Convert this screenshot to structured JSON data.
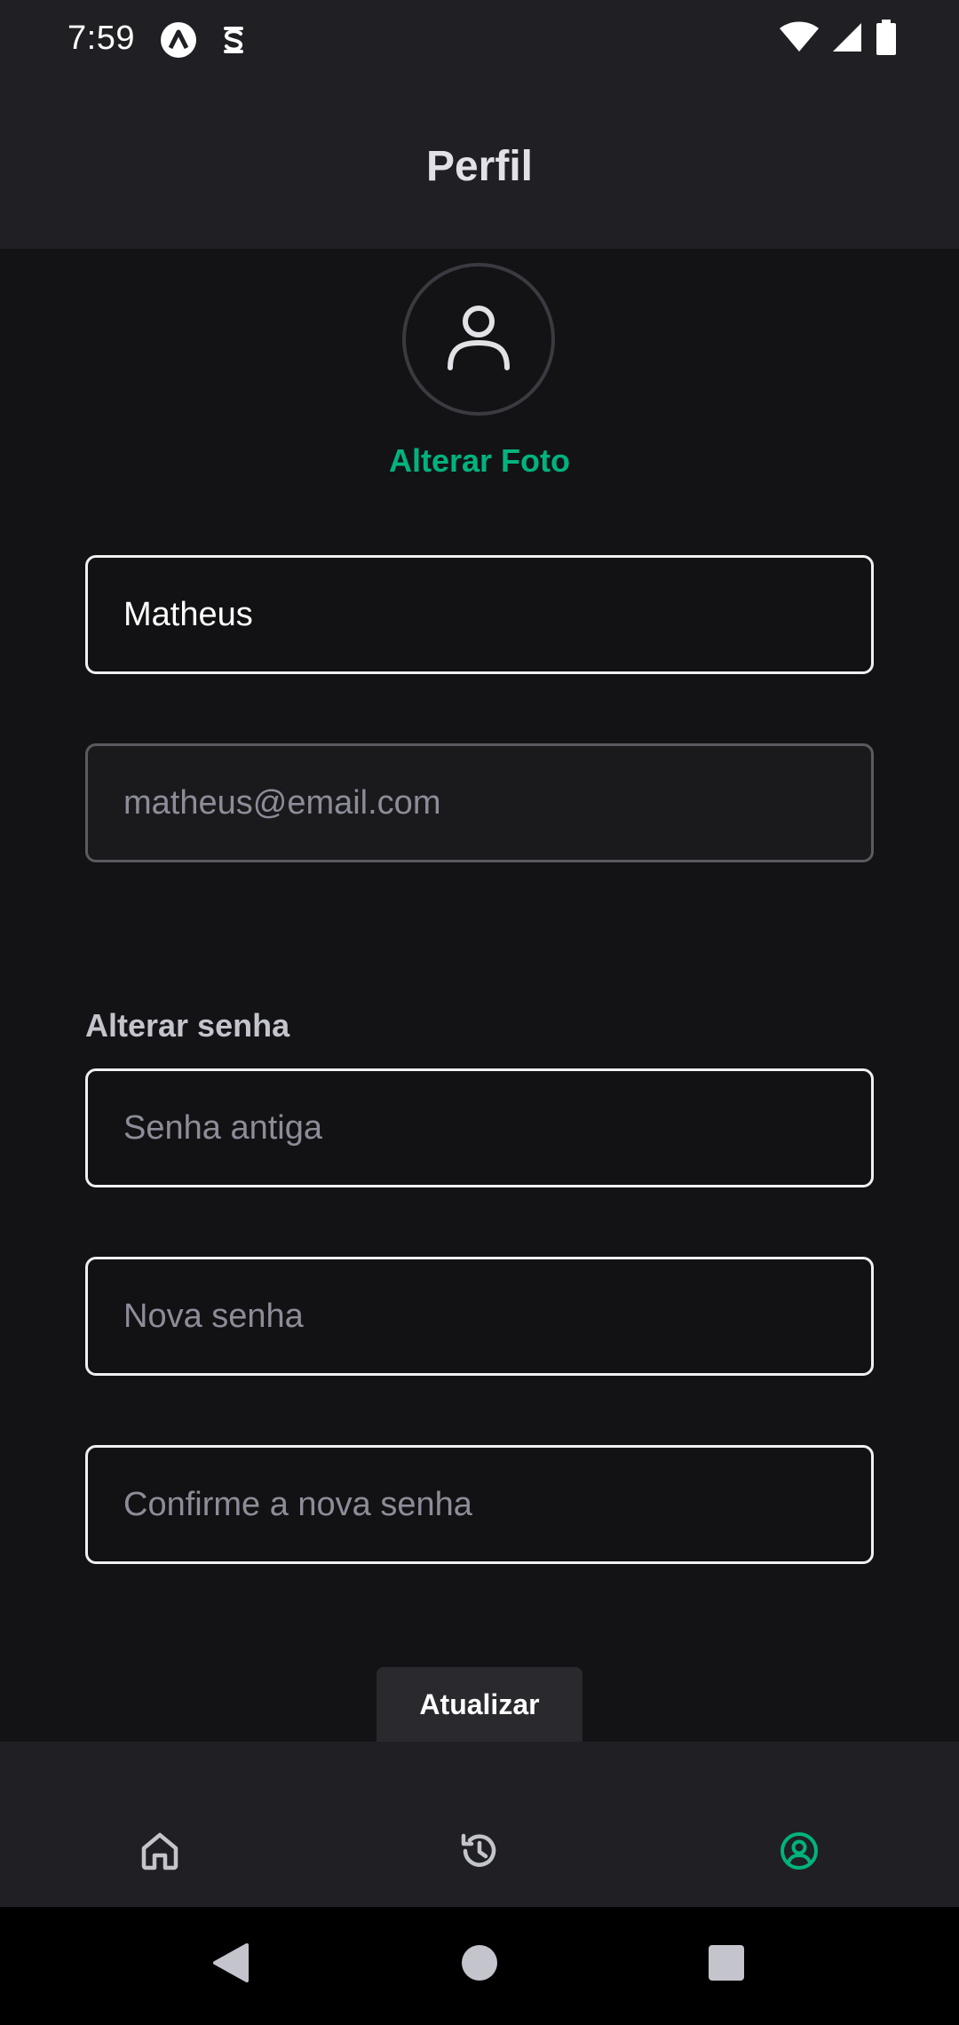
{
  "status_bar": {
    "time": "7:59"
  },
  "header": {
    "title": "Perfil"
  },
  "profile": {
    "change_photo_label": "Alterar Foto"
  },
  "form": {
    "name_value": "Matheus",
    "email_value": "matheus@email.com",
    "password_section_label": "Alterar senha",
    "old_password_placeholder": "Senha antiga",
    "new_password_placeholder": "Nova senha",
    "confirm_password_placeholder": "Confirme a nova senha",
    "submit_label": "Atualizar"
  },
  "tabs": [
    {
      "icon": "home-icon",
      "active": false
    },
    {
      "icon": "history-icon",
      "active": false
    },
    {
      "icon": "profile-icon",
      "active": true
    }
  ],
  "colors": {
    "accent": "#00b37e",
    "background": "#131316",
    "surface": "#202024"
  }
}
